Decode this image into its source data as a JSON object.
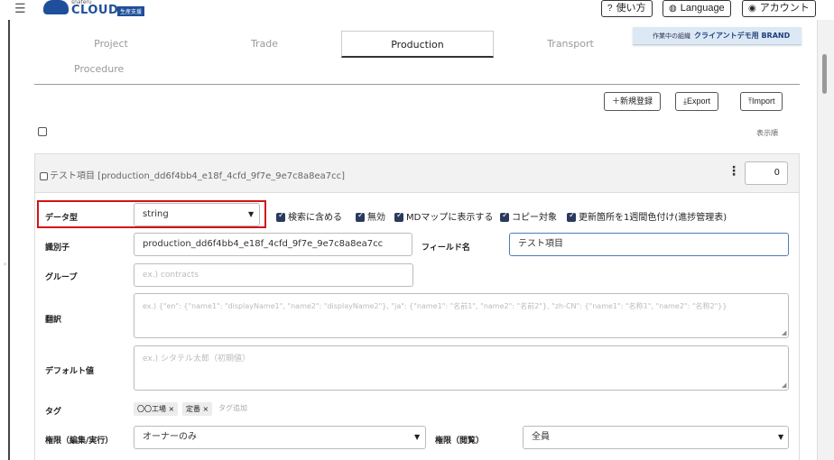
{
  "header": {
    "logo_small": "snaferu",
    "logo_word": "CLOUD",
    "logo_sub": "生産支援",
    "help_label": "使い方",
    "language_label": "Language",
    "account_label": "アカウント"
  },
  "tabs": [
    "Project",
    "Trade",
    "Production",
    "Transport",
    "Procedure"
  ],
  "active_tab": "Production",
  "org_badge": {
    "prefix": "作業中の組織",
    "name": "クライアントデモ用 BRAND"
  },
  "actions": {
    "new_label": "＋新規登録",
    "export_label": "⤓Export",
    "import_label": "⤒Import"
  },
  "list": {
    "sort_label": "表示順"
  },
  "item": {
    "title": "テスト項目 [production_dd6f4bb4_e18f_4cfd_9f7e_9e7c8a8ea7cc]",
    "order_value": "0"
  },
  "form": {
    "datatype_label": "データ型",
    "datatype_value": "string",
    "options": [
      {
        "label": "検索に含める",
        "checked": true
      },
      {
        "label": "無効",
        "checked": true
      },
      {
        "label": "MDマップに表示する",
        "checked": true
      },
      {
        "label": "コピー対象",
        "checked": true
      },
      {
        "label": "更新箇所を1週間色付け(進捗管理表)",
        "checked": true
      }
    ],
    "identifier_label": "識別子",
    "identifier_value": "production_dd6f4bb4_e18f_4cfd_9f7e_9e7c8a8ea7cc",
    "fieldname_label": "フィールド名",
    "fieldname_value": "テスト項目",
    "group_label": "グループ",
    "group_placeholder": "ex.) contracts",
    "translation_label": "翻訳",
    "translation_placeholder": "ex.) {\"en\": {\"name1\": \"displayName1\", \"name2\": \"displayName2\"}, \"ja\": {\"name1\": \"名前1\", \"name2\": \"名前2\"}, \"zh-CN\": {\"name1\": \"名称1\", \"name2\": \"名称2\"}}",
    "default_label": "デフォルト値",
    "default_placeholder": "ex.) シタテル太郎（初期値）",
    "tags_label": "タグ",
    "tags": [
      "〇〇工場 ×",
      "定番 ×"
    ],
    "tag_add_placeholder": "タグ追加",
    "perm_edit_label": "権限（編集/実行）",
    "perm_edit_value": "オーナーのみ",
    "perm_view_label": "権限（閲覧）",
    "perm_view_value": "全員"
  }
}
